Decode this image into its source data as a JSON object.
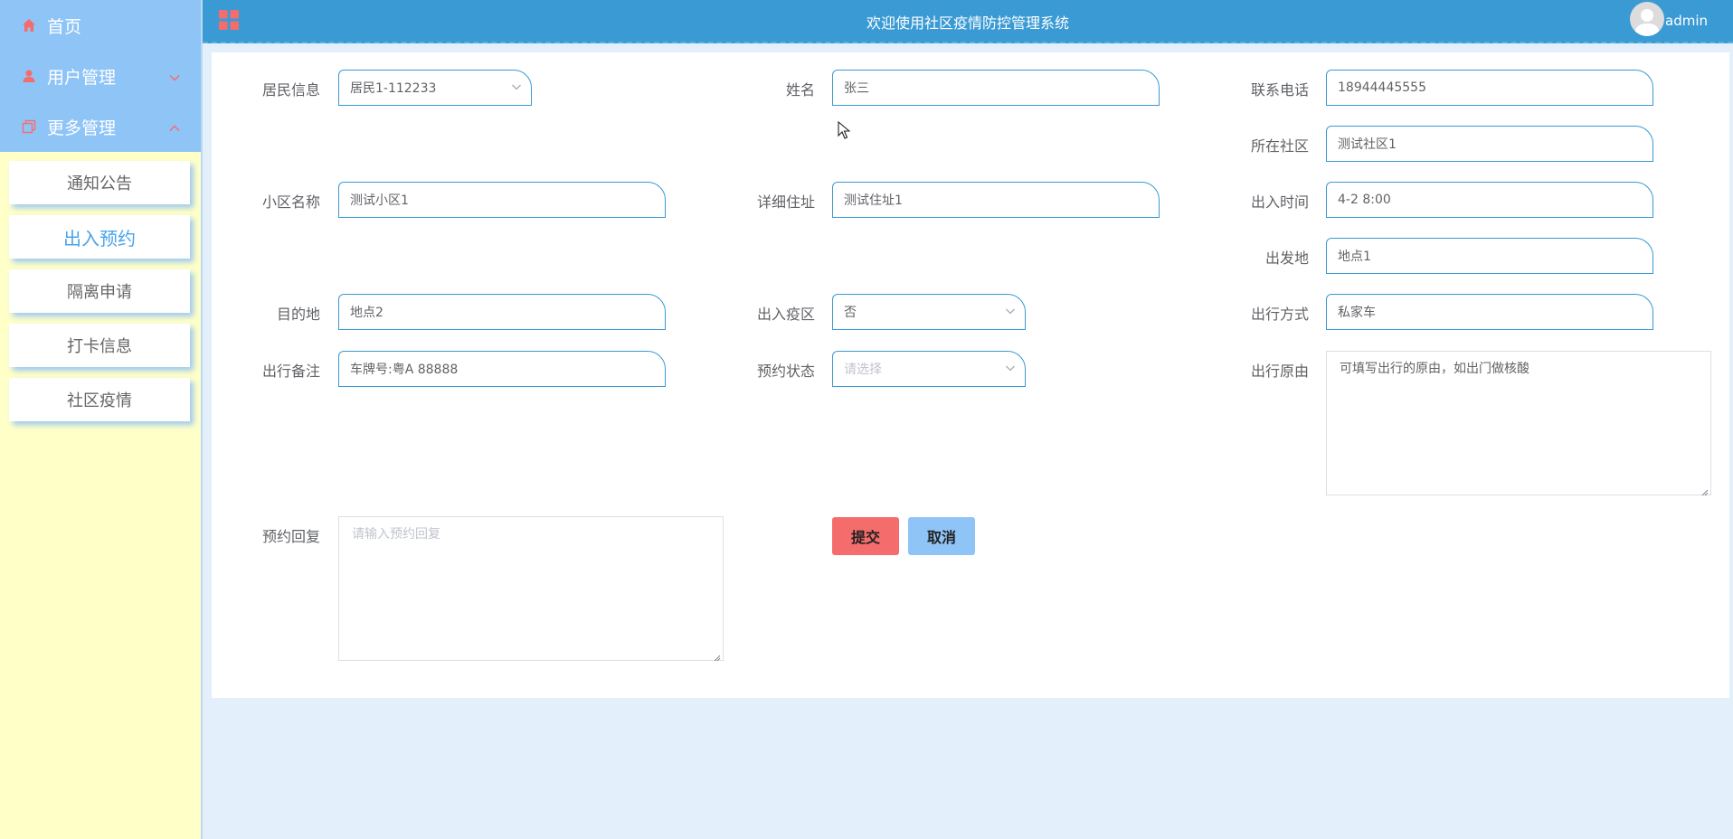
{
  "header": {
    "title": "欢迎使用社区疫情防控管理系统",
    "username": "admin"
  },
  "sidebar": {
    "items": [
      {
        "label": "首页",
        "icon": "home-icon"
      },
      {
        "label": "用户管理",
        "icon": "user-icon",
        "chevron": "down"
      },
      {
        "label": "更多管理",
        "icon": "copy-icon",
        "chevron": "up"
      }
    ],
    "submenu": [
      {
        "label": "通知公告"
      },
      {
        "label": "出入预约",
        "active": true
      },
      {
        "label": "隔离申请"
      },
      {
        "label": "打卡信息"
      },
      {
        "label": "社区疫情"
      }
    ]
  },
  "form": {
    "resident": {
      "label": "居民信息",
      "value": "居民1-112233"
    },
    "name": {
      "label": "姓名",
      "value": "张三"
    },
    "phone": {
      "label": "联系电话",
      "value": "18944445555"
    },
    "community": {
      "label": "所在社区",
      "value": "测试社区1"
    },
    "estate": {
      "label": "小区名称",
      "value": "测试小区1"
    },
    "address": {
      "label": "详细住址",
      "value": "测试住址1"
    },
    "time": {
      "label": "出入时间",
      "value": "4-2 8:00"
    },
    "origin": {
      "label": "出发地",
      "value": "地点1"
    },
    "destination": {
      "label": "目的地",
      "value": "地点2"
    },
    "risk_area": {
      "label": "出入疫区",
      "value": "否"
    },
    "transport": {
      "label": "出行方式",
      "value": "私家车"
    },
    "note": {
      "label": "出行备注",
      "value": "车牌号:粤A 88888"
    },
    "status": {
      "label": "预约状态",
      "placeholder": "请选择"
    },
    "reason": {
      "label": "出行原由",
      "value": "可填写出行的原由，如出门做核酸"
    },
    "reply": {
      "label": "预约回复",
      "placeholder": "请输入预约回复"
    }
  },
  "buttons": {
    "submit": "提交",
    "cancel": "取消"
  },
  "colors": {
    "header": "#3a9ad4",
    "sidebar_top": "#8fc4f7",
    "sidebar_bg": "#ffffc8",
    "accent": "#4ba3e8",
    "submit": "#f56c6c",
    "cancel": "#8fc4f7"
  }
}
